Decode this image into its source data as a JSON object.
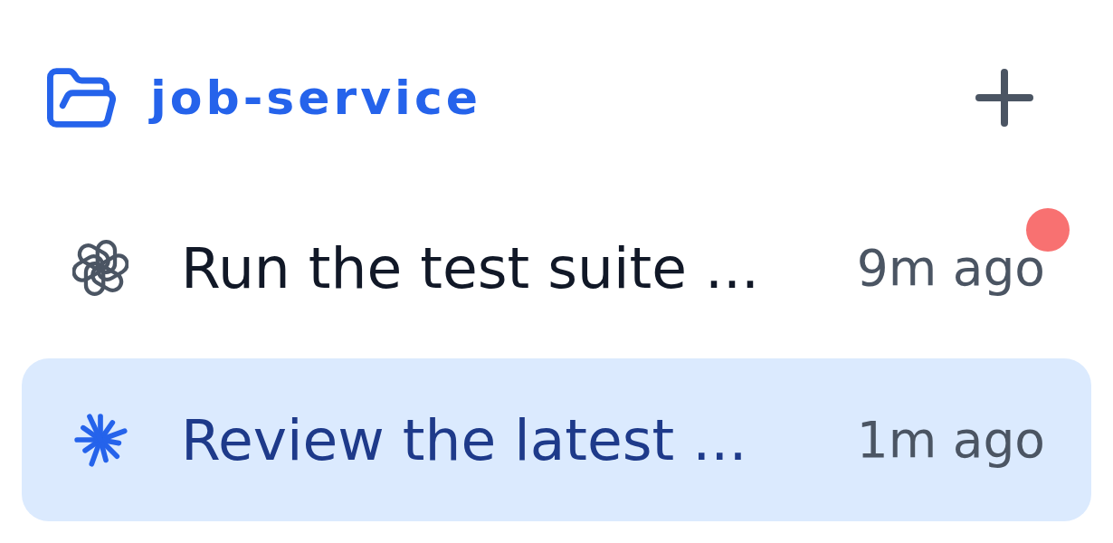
{
  "project": {
    "name": "job-service"
  },
  "sessions": [
    {
      "kind": "knot",
      "title": "Run the test suite ...",
      "time": "9m ago",
      "unread": true,
      "selected": false
    },
    {
      "kind": "spark",
      "title": "Review the latest ...",
      "time": "1m ago",
      "unread": false,
      "selected": true
    }
  ]
}
